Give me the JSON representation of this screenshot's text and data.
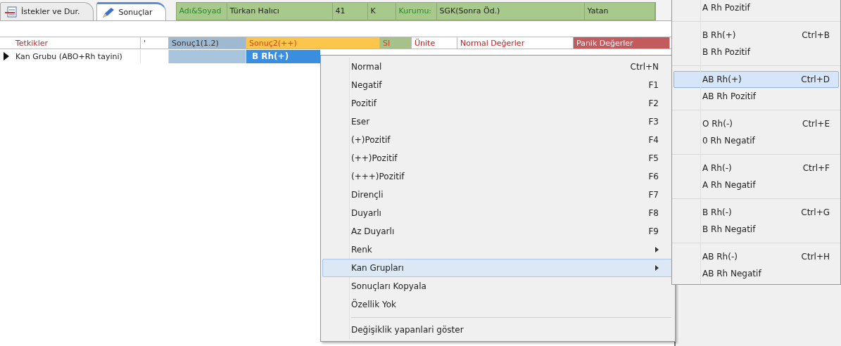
{
  "tabs": [
    {
      "label": "İstekler ve Dur.",
      "selected": false
    },
    {
      "label": "Sonuçlar",
      "selected": true
    }
  ],
  "patient": [
    {
      "kind": "label",
      "text": "Adı&Soyad"
    },
    {
      "kind": "value",
      "text": "Türkan Halıcı"
    },
    {
      "kind": "value",
      "text": "41"
    },
    {
      "kind": "value",
      "text": "K"
    },
    {
      "kind": "label",
      "text": "Kurumu:"
    },
    {
      "kind": "value",
      "text": "SGK(Sonra Öd.)"
    },
    {
      "kind": "value",
      "text": "Yatan"
    }
  ],
  "table": {
    "columns": [
      {
        "label": "Tetkikler",
        "color": "#ffffff"
      },
      {
        "label": "'",
        "color": "#ffffff"
      },
      {
        "label": "Sonuç1(1.2)",
        "color": "#9fb9d1"
      },
      {
        "label": "Sonuç2(++)",
        "color": "#fcc64c"
      },
      {
        "label": "SI",
        "color": "#a6c28a"
      },
      {
        "label": "Ünite",
        "color": "#ffffff"
      },
      {
        "label": "Normal Değerler",
        "color": "#ffffff"
      },
      {
        "label": "Panik Değerler",
        "color": "#c25b5e"
      }
    ],
    "rows": [
      {
        "test": "Kan Grubu (ABO+Rh tayini)",
        "result_2": "B Rh(+)",
        "current": true,
        "selected": true
      }
    ]
  },
  "context_menu": {
    "items": [
      {
        "label": "Normal",
        "shortcut": "Ctrl+N",
        "submenu": false,
        "selected": false,
        "separator_before": false
      },
      {
        "label": "Negatif",
        "shortcut": "F1",
        "submenu": false,
        "selected": false,
        "separator_before": false
      },
      {
        "label": "Pozitif",
        "shortcut": "F2",
        "submenu": false,
        "selected": false,
        "separator_before": false
      },
      {
        "label": "Eser",
        "shortcut": "F3",
        "submenu": false,
        "selected": false,
        "separator_before": false
      },
      {
        "label": "(+)Pozitif",
        "shortcut": "F4",
        "submenu": false,
        "selected": false,
        "separator_before": false
      },
      {
        "label": "(++)Pozitif",
        "shortcut": "F5",
        "submenu": false,
        "selected": false,
        "separator_before": false
      },
      {
        "label": "(+++)Pozitif",
        "shortcut": "F6",
        "submenu": false,
        "selected": false,
        "separator_before": false
      },
      {
        "label": "Dirençli",
        "shortcut": "F7",
        "submenu": false,
        "selected": false,
        "separator_before": false
      },
      {
        "label": "Duyarlı",
        "shortcut": "F8",
        "submenu": false,
        "selected": false,
        "separator_before": false
      },
      {
        "label": "Az Duyarlı",
        "shortcut": "F9",
        "submenu": false,
        "selected": false,
        "separator_before": false
      },
      {
        "label": "Renk",
        "submenu": true,
        "selected": false,
        "separator_before": false
      },
      {
        "label": "Kan Grupları",
        "submenu": true,
        "selected": true,
        "separator_before": false
      },
      {
        "label": "Sonuçları  Kopyala",
        "submenu": false,
        "selected": false,
        "separator_before": false
      },
      {
        "label": "Özellik Yok",
        "submenu": false,
        "selected": false,
        "separator_before": false
      },
      {
        "label": "Değişiklik yapanlari göster",
        "submenu": false,
        "selected": false,
        "separator_before": true
      }
    ]
  },
  "blood_group_menu": {
    "items": [
      {
        "description": "A Rh Pozitif",
        "selected": false
      },
      {
        "label": "B Rh(+)",
        "shortcut": "Ctrl+B",
        "description": "B Rh Pozitif",
        "selected": false
      },
      {
        "label": "AB Rh(+)",
        "shortcut": "Ctrl+D",
        "description": "AB Rh Pozitif",
        "selected": true
      },
      {
        "label": "O Rh(-)",
        "shortcut": "Ctrl+E",
        "description": "0 Rh Negatif",
        "selected": false
      },
      {
        "label": "A Rh(-)",
        "shortcut": "Ctrl+F",
        "description": "A Rh Negatif",
        "selected": false
      },
      {
        "label": "B Rh(-)",
        "shortcut": "Ctrl+G",
        "description": "B Rh Negatif",
        "selected": false
      },
      {
        "label": "AB Rh(-)",
        "shortcut": "Ctrl+H",
        "description": "AB Rh Negatif",
        "selected": false
      }
    ]
  }
}
